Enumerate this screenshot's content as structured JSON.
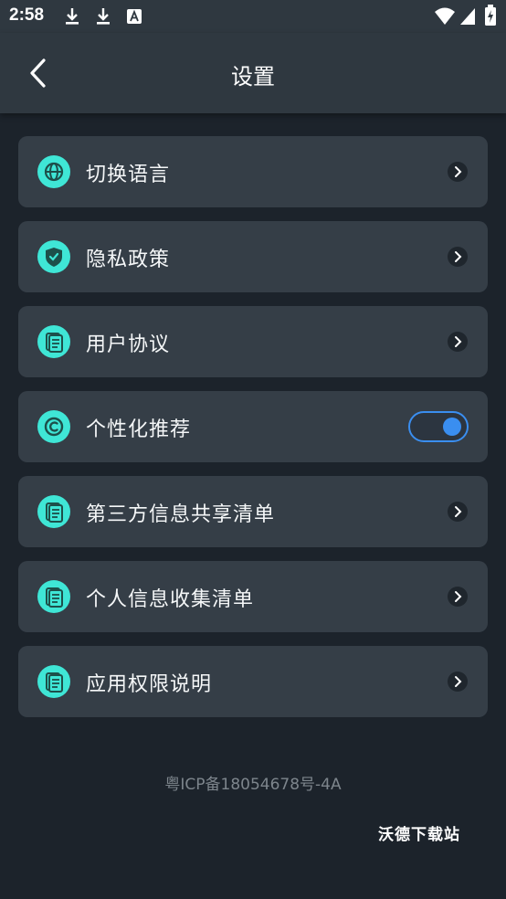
{
  "status_bar": {
    "time": "2:58",
    "icons": [
      "download-icon",
      "download-icon",
      "text-a-icon",
      "wifi-icon",
      "signal-icon",
      "battery-icon"
    ]
  },
  "header": {
    "title": "设置",
    "back_icon": "chevron-left-icon"
  },
  "menu": {
    "items": [
      {
        "label": "切换语言",
        "icon": "globe-icon"
      },
      {
        "label": "隐私政策",
        "icon": "shield-check-icon"
      },
      {
        "label": "用户协议",
        "icon": "document-icon"
      },
      {
        "label": "个性化推荐",
        "icon": "copyright-icon",
        "toggle": true
      },
      {
        "label": "第三方信息共享清单",
        "icon": "document-icon"
      },
      {
        "label": "个人信息收集清单",
        "icon": "document-icon"
      },
      {
        "label": "应用权限说明",
        "icon": "document-icon"
      }
    ]
  },
  "footer": {
    "icp": "粤ICP备18054678号-4A",
    "watermark": "沃德下载站"
  },
  "colors": {
    "background": "#1c232b",
    "bar": "#2f3840",
    "card": "#353e47",
    "icon_accent": "#3fe6d6",
    "toggle_on": "#3a8ef0"
  }
}
